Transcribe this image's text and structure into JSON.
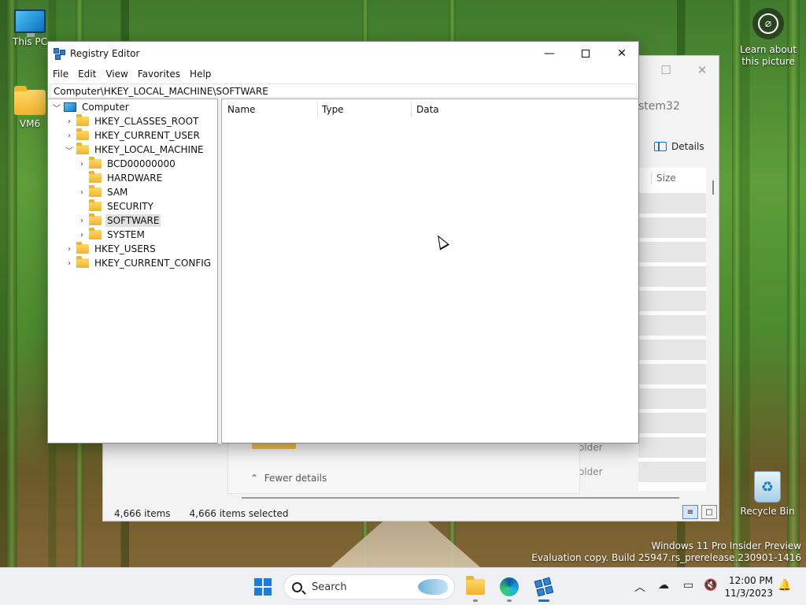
{
  "desktop": {
    "icons": [
      {
        "label": "This PC",
        "icon": "monitor-icon"
      },
      {
        "label": "VM6",
        "icon": "folder-icon"
      },
      {
        "label": "Recycle Bin",
        "icon": "recycle-bin-icon"
      }
    ],
    "learn_line1": "Learn about",
    "learn_line2": "this picture",
    "watermark_line1": "Windows 11 Pro Insider Preview",
    "watermark_line2": "Evaluation copy. Build 25947.rs_prerelease.230901-1416"
  },
  "explorer": {
    "path_fragment": "stem32",
    "details_label": "Details",
    "size_header": "Size",
    "folder_label_1": "older",
    "folder_label_2": "older",
    "fewer_details": "Fewer details",
    "status_items": "4,666 items",
    "status_selected": "4,666 items selected"
  },
  "regedit": {
    "title": "Registry Editor",
    "menu": [
      "File",
      "Edit",
      "View",
      "Favorites",
      "Help"
    ],
    "address": "Computer\\HKEY_LOCAL_MACHINE\\SOFTWARE",
    "tree": {
      "root": "Computer",
      "hkcr": "HKEY_CLASSES_ROOT",
      "hkcu": "HKEY_CURRENT_USER",
      "hklm": "HKEY_LOCAL_MACHINE",
      "hklm_children": [
        "BCD00000000",
        "HARDWARE",
        "SAM",
        "SECURITY",
        "SOFTWARE",
        "SYSTEM"
      ],
      "hku": "HKEY_USERS",
      "hkcc": "HKEY_CURRENT_CONFIG",
      "selected": "SOFTWARE"
    },
    "columns": [
      "Name",
      "Type",
      "Data"
    ]
  },
  "taskbar": {
    "search_placeholder": "Search",
    "time": "12:00 PM",
    "date": "11/3/2023"
  }
}
